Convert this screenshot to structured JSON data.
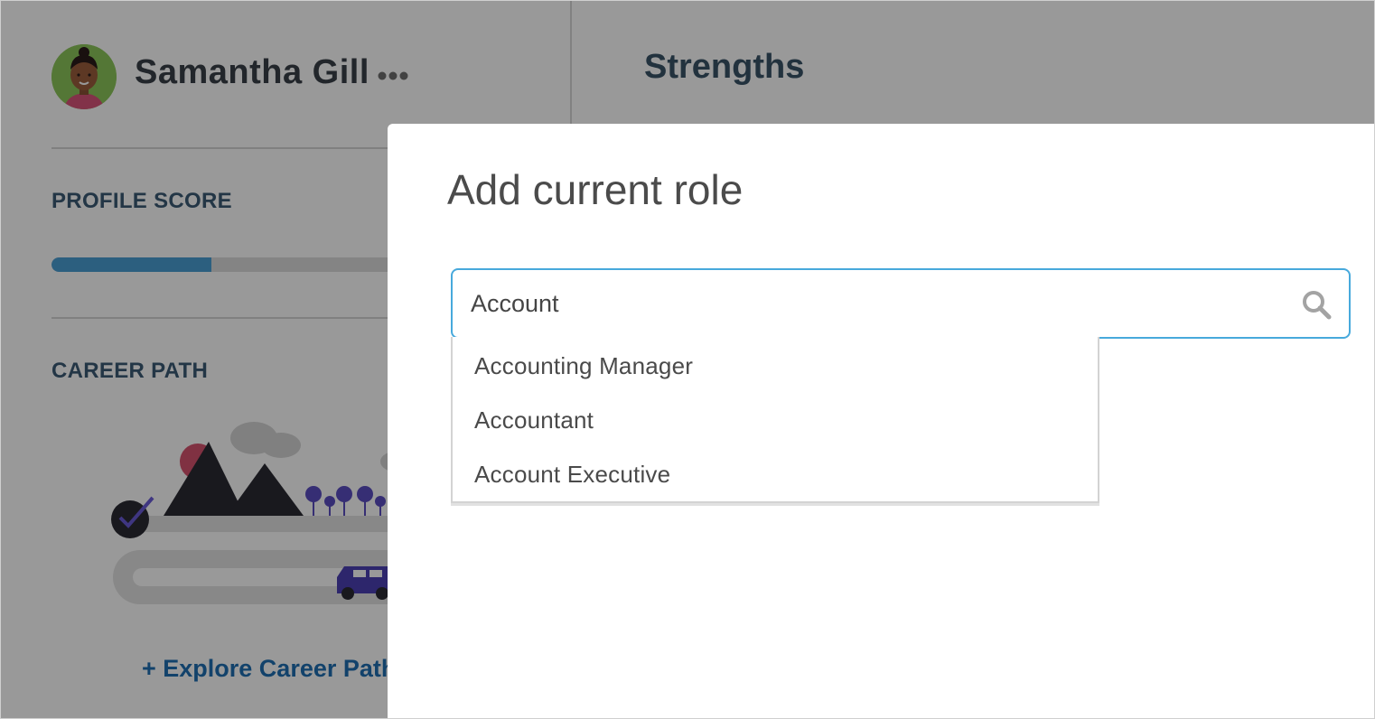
{
  "profile": {
    "name": "Samantha Gill",
    "profile_score_label": "PROFILE SCORE",
    "profile_score_fraction": 0.31,
    "career_path_label": "CAREER PATH",
    "explore_link": "+ Explore Career Path"
  },
  "main": {
    "strengths_title": "Strengths"
  },
  "modal": {
    "title": "Add current role",
    "search_value": "Account",
    "suggestions": [
      "Accounting Manager",
      "Accountant",
      "Account Executive"
    ]
  },
  "colors": {
    "accent_blue": "#47a9dc",
    "progress_fill": "#4a9fd4",
    "link_blue": "#1f6fb2",
    "overlay": "rgba(0,0,0,0.40)"
  },
  "icons": {
    "avatar": "user-avatar-icon",
    "more": "more-dots-icon",
    "search": "search-icon",
    "career": "career-path-illustration"
  }
}
